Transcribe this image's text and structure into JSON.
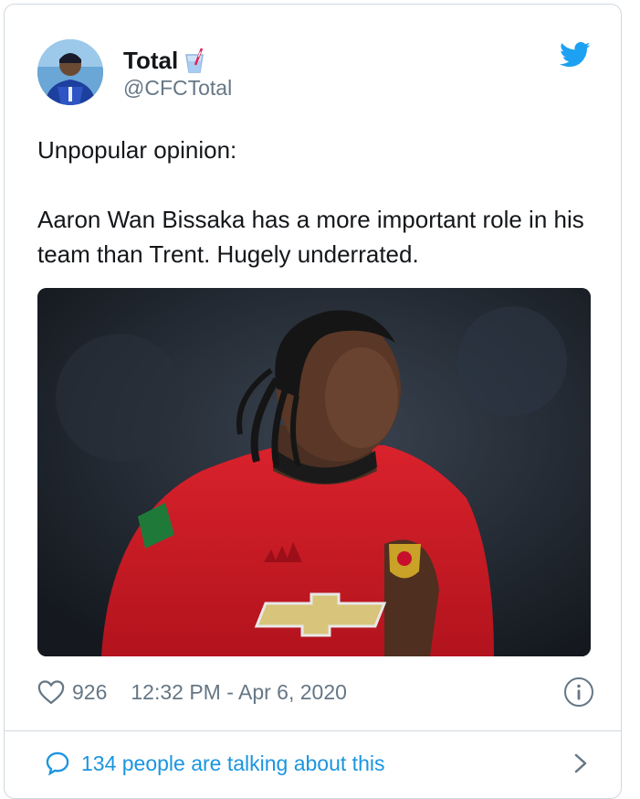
{
  "author": {
    "display_name": "Total",
    "handle": "@CFCTotal",
    "name_emoji_icon": "cup-with-straw-icon",
    "avatar": "avatar-photo"
  },
  "tweet": {
    "lines": [
      "Unpopular opinion:",
      "Aaron Wan Bissaka has a more important role in his team than Trent. Hugely underrated."
    ],
    "media": "footballer-photo"
  },
  "meta": {
    "like_count": "926",
    "timestamp": "12:32 PM - Apr 6, 2020"
  },
  "footer": {
    "talking_text": "134 people are talking about this"
  },
  "colors": {
    "twitter_blue": "#1da1f2",
    "link_blue": "#1b95e0",
    "secondary_text": "#657786",
    "border": "#cfd9de"
  }
}
